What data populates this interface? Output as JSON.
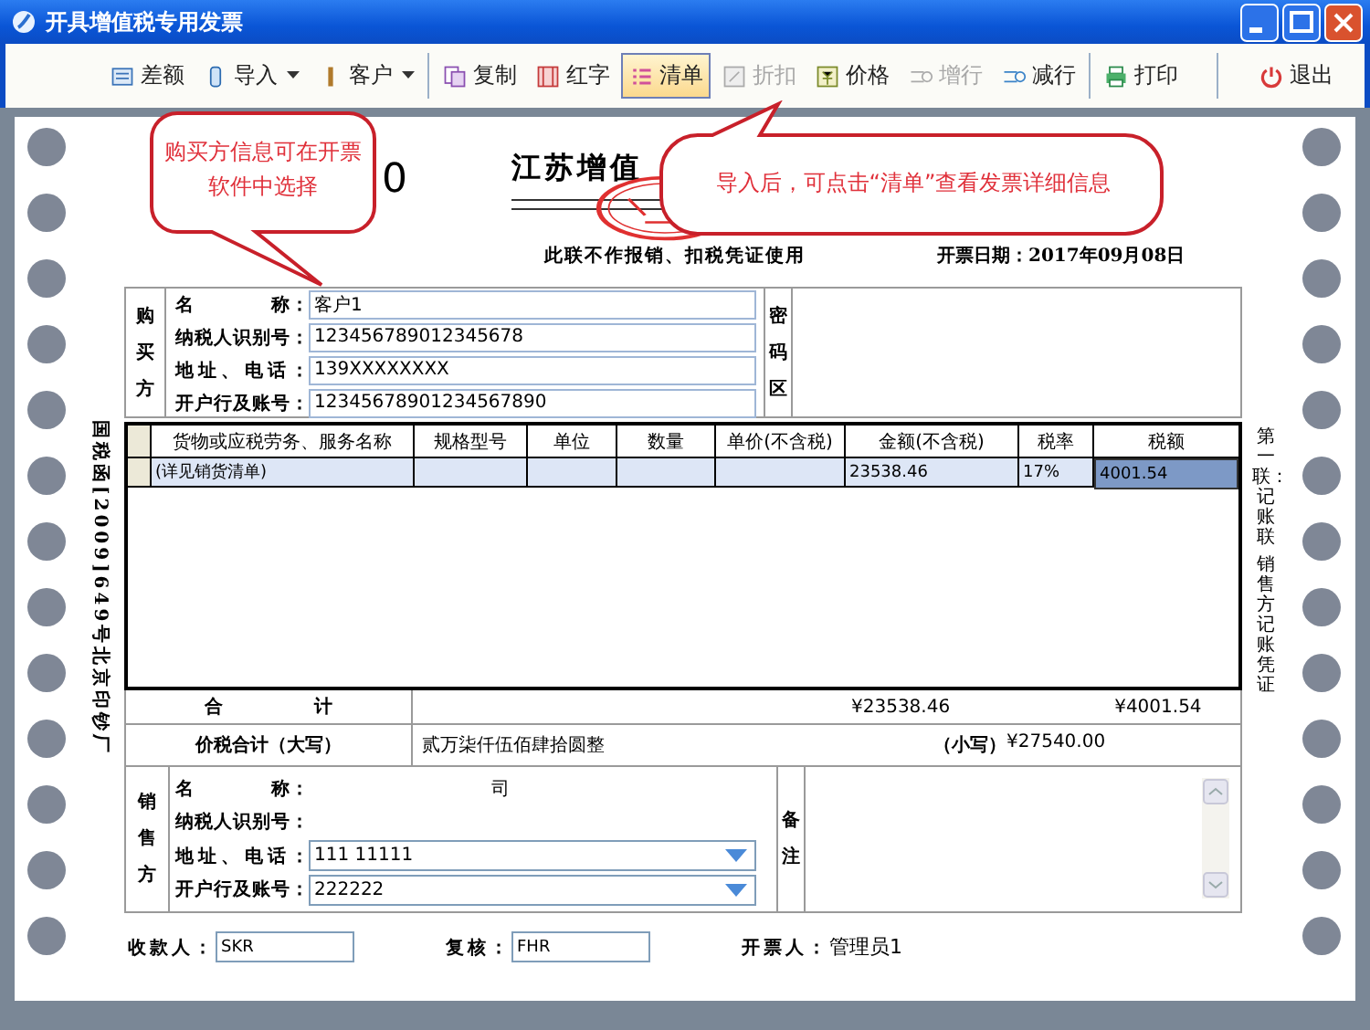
{
  "window": {
    "title": "开具增值税专用发票"
  },
  "toolbar": {
    "groups": [
      {
        "items": [
          {
            "label": "差额",
            "selected": false,
            "disabled": false,
            "dropdown": false
          },
          {
            "label": "导入",
            "selected": false,
            "disabled": false,
            "dropdown": true
          },
          {
            "label": "客户",
            "selected": false,
            "disabled": false,
            "dropdown": true
          }
        ]
      },
      {
        "items": [
          {
            "label": "复制",
            "selected": false,
            "disabled": false,
            "dropdown": false
          },
          {
            "label": "红字",
            "selected": false,
            "disabled": false,
            "dropdown": false
          },
          {
            "label": "清单",
            "selected": true,
            "disabled": false,
            "dropdown": false
          },
          {
            "label": "折扣",
            "selected": false,
            "disabled": true,
            "dropdown": false
          },
          {
            "label": "价格",
            "selected": false,
            "disabled": false,
            "dropdown": false
          },
          {
            "label": "增行",
            "selected": false,
            "disabled": true,
            "dropdown": false
          },
          {
            "label": "减行",
            "selected": false,
            "disabled": false,
            "dropdown": false
          }
        ]
      },
      {
        "items": [
          {
            "label": "打印",
            "selected": false,
            "disabled": false,
            "dropdown": false
          }
        ]
      },
      {
        "items": [
          {
            "label": "退出",
            "selected": false,
            "disabled": false,
            "dropdown": false
          }
        ]
      }
    ]
  },
  "callouts": [
    {
      "text": "购买方信息可在开票软件中选择"
    },
    {
      "text": "导入后，可点击“清单”查看发票详细信息"
    }
  ],
  "invoice": {
    "number_fragment": "0",
    "title": "江苏增值",
    "notice": "此联不作报销、扣税凭证使用",
    "date_label": "开票日期：",
    "date": "2017年09月08日",
    "left_margin_text": "国税函[2009]649号北京印钞厂",
    "right_margin_texts": [
      "第一联：记账联",
      "销售方记账凭证"
    ],
    "buyer": {
      "label": "购买方",
      "cipher_label": "密码区",
      "fields": [
        {
          "label": "名　　　　称：",
          "value": "客户1",
          "kind": "input"
        },
        {
          "label": "纳税人识别号：",
          "value": "123456789012345678",
          "kind": "input"
        },
        {
          "label": "地址、电话：",
          "value": "139XXXXXXXX",
          "kind": "input"
        },
        {
          "label": "开户行及账号：",
          "value": "12345678901234567890",
          "kind": "input"
        }
      ]
    },
    "goods": {
      "columns": [
        "货物或应税劳务、服务名称",
        "规格型号",
        "单位",
        "数量",
        "单价(不含税)",
        "金额(不含税)",
        "税率",
        "税额"
      ],
      "rows": [
        {
          "cells": [
            {
              "text": "(详见销货清单)",
              "selected": false
            },
            {
              "selected": false
            },
            {
              "selected": false
            },
            {
              "selected": false
            },
            {
              "selected": false
            },
            {
              "text": "23538.46",
              "selected": false
            },
            {
              "text": "17%",
              "selected": false
            },
            {
              "text": "4001.54",
              "selected": true
            }
          ]
        }
      ]
    },
    "total_label": "合　　　　　计",
    "total_amount": "¥23538.46",
    "total_tax": "¥4001.54",
    "grand_label": "价税合计（大写）",
    "grand_words": "贰万柒仟伍佰肆拾圆整",
    "grand_small_label": "（小写）",
    "grand_amount": "¥27540.00",
    "seller": {
      "label": "销售方",
      "remarks_label": "备注",
      "fields": [
        {
          "label": "名　　　　称：",
          "value": "司",
          "kind": "plain"
        },
        {
          "label": "纳税人识别号：",
          "kind": "plain"
        },
        {
          "label": "地址、电话：",
          "value": "111 11111",
          "kind": "select"
        },
        {
          "label": "开户行及账号：",
          "value": "222222",
          "kind": "select"
        }
      ]
    },
    "footer": [
      {
        "label": "收款人：",
        "value": "SKR",
        "kind": "input"
      },
      {
        "label": "复核：",
        "value": "FHR",
        "kind": "input"
      },
      {
        "label": "开票人：",
        "value": "管理员1",
        "kind": "plain"
      }
    ]
  }
}
